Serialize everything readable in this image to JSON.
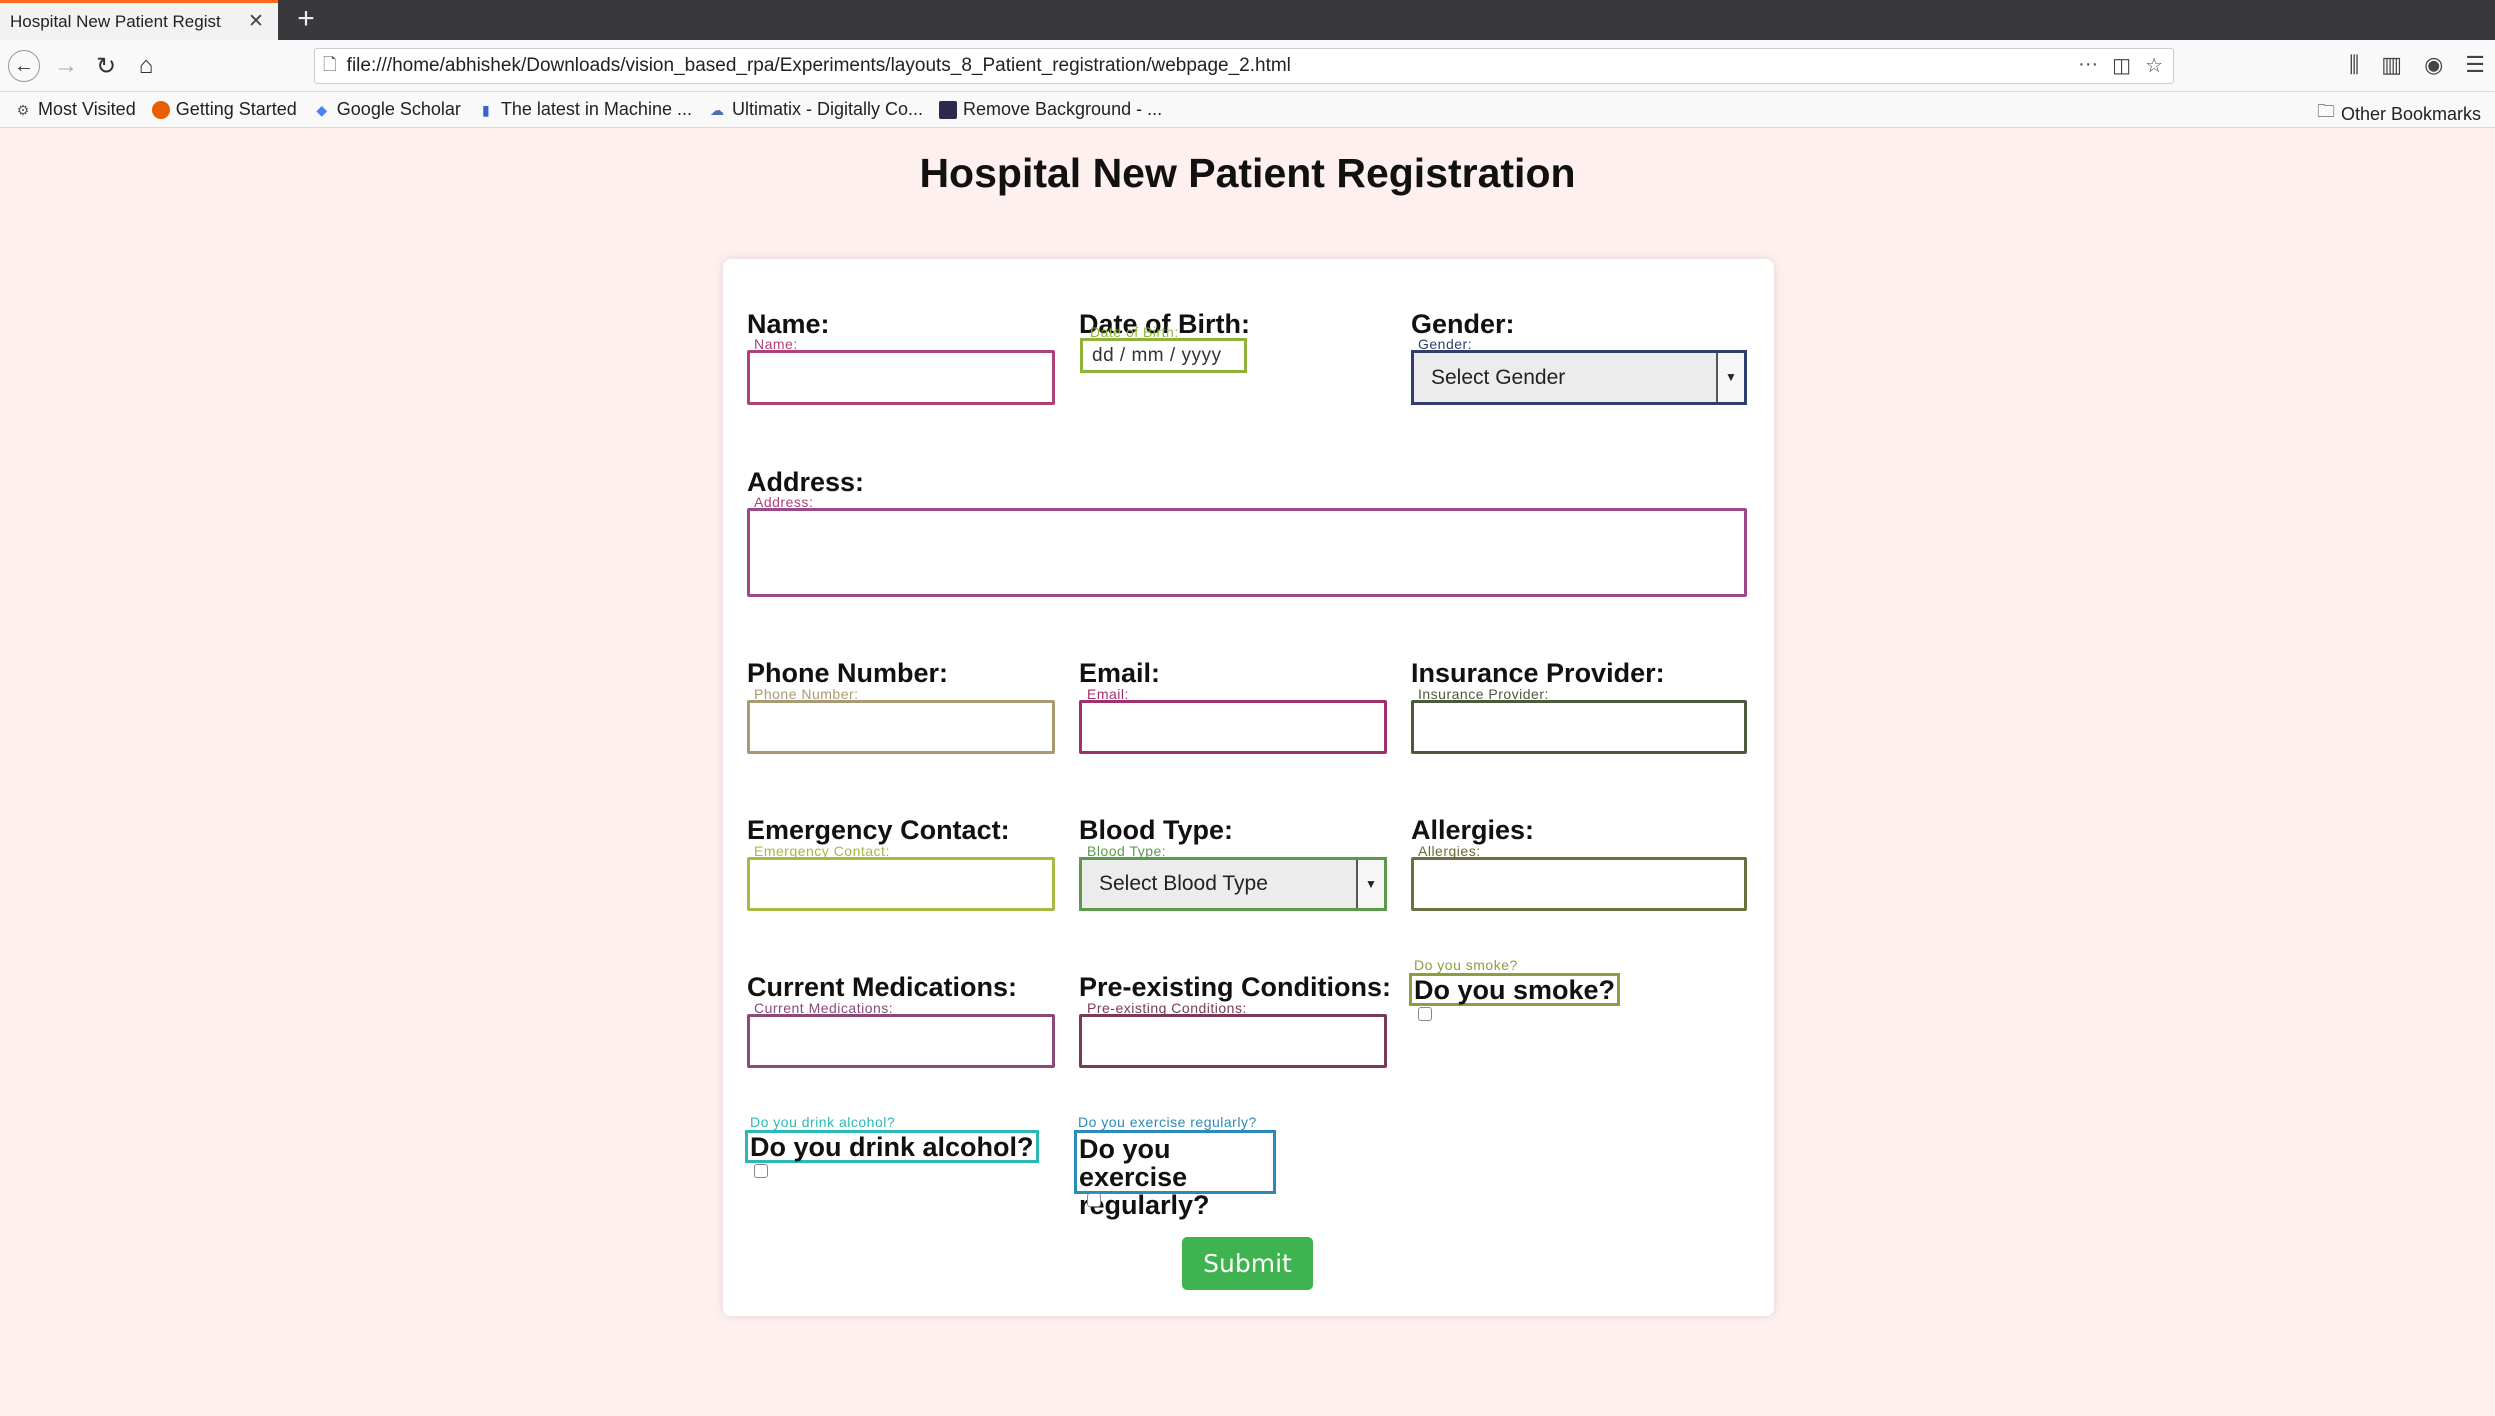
{
  "browser": {
    "tab_title": "Hospital New Patient Regist",
    "tab_close": "✕",
    "new_tab": "+",
    "url": "file:///home/abhishek/Downloads/vision_based_rpa/Experiments/layouts_8_Patient_registration/webpage_2.html",
    "bookmarks": [
      {
        "label": "Most Visited",
        "icon": "gear-icon"
      },
      {
        "label": "Getting Started",
        "icon": "firefox-icon"
      },
      {
        "label": "Google Scholar",
        "icon": "scholar-icon"
      },
      {
        "label": "The latest in Machine ...",
        "icon": "ml-icon"
      },
      {
        "label": "Ultimatix - Digitally Co...",
        "icon": "ultimatix-icon"
      },
      {
        "label": "Remove Background - ...",
        "icon": "removebg-icon"
      }
    ],
    "other_bookmarks": "Other Bookmarks"
  },
  "page": {
    "title": "Hospital New Patient Registration",
    "submit_label": "Submit"
  },
  "fields": {
    "name": {
      "label": "Name:",
      "tiny": "Name:"
    },
    "dob": {
      "label": "Date of Birth:",
      "tiny": "Date of Birth:",
      "placeholder": "dd / mm / yyyy"
    },
    "gender": {
      "label": "Gender:",
      "tiny": "Gender:",
      "selected": "Select Gender"
    },
    "address": {
      "label": "Address:",
      "tiny": "Address:"
    },
    "phone": {
      "label": "Phone Number:",
      "tiny": "Phone Number:"
    },
    "email": {
      "label": "Email:",
      "tiny": "Email:"
    },
    "insurance": {
      "label": "Insurance Provider:",
      "tiny": "Insurance Provider:"
    },
    "emergency": {
      "label": "Emergency Contact:",
      "tiny": "Emergency Contact:"
    },
    "blood": {
      "label": "Blood Type:",
      "tiny": "Blood Type:",
      "selected": "Select Blood Type"
    },
    "allergies": {
      "label": "Allergies:",
      "tiny": "Allergies:"
    },
    "medications": {
      "label": "Current Medications:",
      "tiny": "Current Medications:"
    },
    "conditions": {
      "label": "Pre-existing Conditions:",
      "tiny": "Pre-existing Conditions:"
    },
    "smoke": {
      "label": "Do you smoke?",
      "tiny": "Do you smoke?"
    },
    "alcohol": {
      "label": "Do you drink alcohol?",
      "tiny": "Do you drink alcohol?"
    },
    "exercise": {
      "label_line1": "Do you exercise",
      "label_line2": "regularly?",
      "tiny": "Do you exercise regularly?"
    }
  },
  "colors": {
    "background": "#fff0f0",
    "submit": "#3fb34f",
    "tab_accent": "#ff6a1a"
  }
}
